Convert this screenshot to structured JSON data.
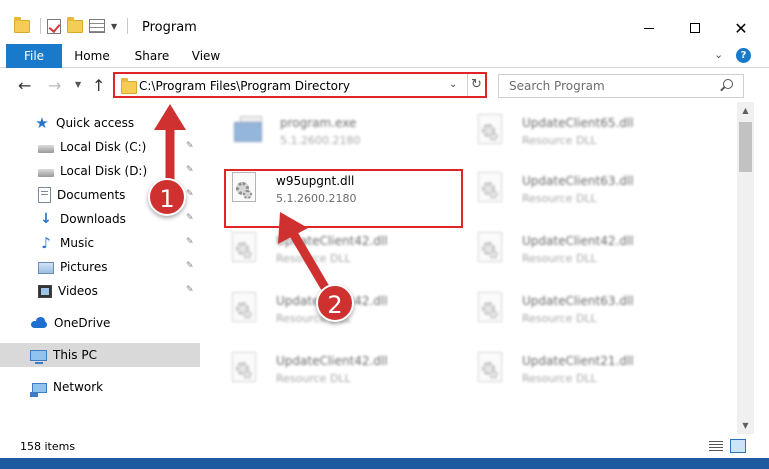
{
  "window": {
    "title": "Program"
  },
  "ribbon": {
    "file": "File",
    "home": "Home",
    "share": "Share",
    "view": "View"
  },
  "address": {
    "path": "C:\\Program Files\\Program Directory",
    "search_placeholder": "Search Program"
  },
  "sidebar": {
    "items": [
      {
        "label": "Quick access",
        "icon": "star-icon"
      },
      {
        "label": "Local Disk (C:)",
        "icon": "disk-icon"
      },
      {
        "label": "Local Disk (D:)",
        "icon": "disk-icon"
      },
      {
        "label": "Documents",
        "icon": "documents-icon"
      },
      {
        "label": "Downloads",
        "icon": "downloads-icon"
      },
      {
        "label": "Music",
        "icon": "music-icon"
      },
      {
        "label": "Pictures",
        "icon": "pictures-icon"
      },
      {
        "label": "Videos",
        "icon": "videos-icon"
      },
      {
        "label": "OneDrive",
        "icon": "cloud-icon"
      },
      {
        "label": "This PC",
        "icon": "pc-icon"
      },
      {
        "label": "Network",
        "icon": "network-icon"
      }
    ]
  },
  "files": [
    {
      "name": "program.exe",
      "meta": "5.1.2600.2180"
    },
    {
      "name": "UpdateClient65.dll",
      "meta": "Resource DLL"
    },
    {
      "name": "w95upgnt.dll",
      "meta": "5.1.2600.2180"
    },
    {
      "name": "UpdateClient63.dll",
      "meta": "Resource DLL"
    },
    {
      "name": "UpdateClient42.dll",
      "meta": "Resource DLL"
    },
    {
      "name": "UpdateClient42.dll",
      "meta": "Resource DLL"
    },
    {
      "name": "UpdateClient42.dll",
      "meta": "Resource DLL"
    },
    {
      "name": "UpdateClient63.dll",
      "meta": "Resource DLL"
    },
    {
      "name": "UpdateClient42.dll",
      "meta": "Resource DLL"
    },
    {
      "name": "UpdateClient21.dll",
      "meta": "Resource DLL"
    }
  ],
  "status": {
    "items": "158 items"
  },
  "annotations": {
    "step1": "1",
    "step2": "2",
    "color": "#cf3131"
  }
}
